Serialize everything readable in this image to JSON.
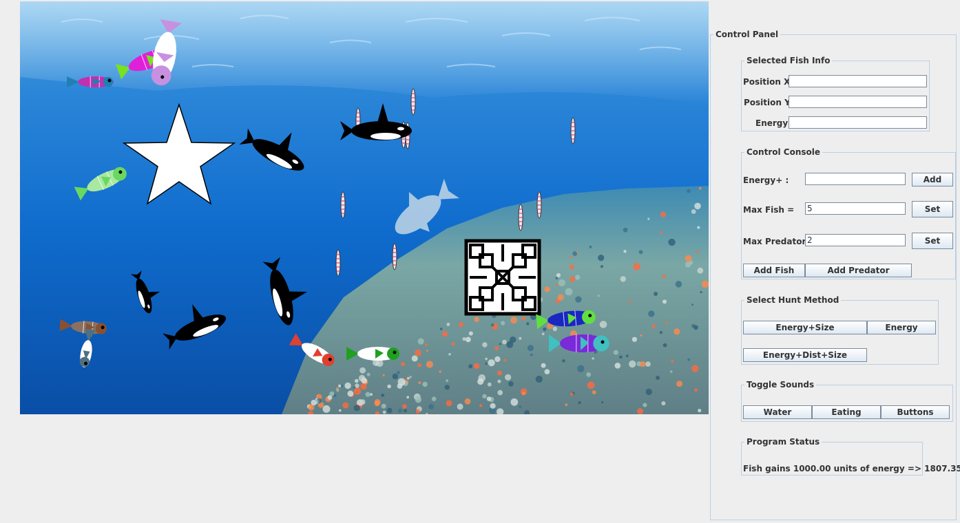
{
  "aquarium": {
    "fish_count": 10,
    "predator_count": 7,
    "colors": {
      "water_top": "#3f9fe0",
      "water_mid": "#0f6fcf",
      "water_deep": "#0a4fa8",
      "reef": "#6b9a9a"
    }
  },
  "control_panel": {
    "title": "Control Panel",
    "selected_fish_info": {
      "title": "Selected Fish Info",
      "position_x_label": "Position X :",
      "position_x_value": "",
      "position_y_label": "Position Y :",
      "position_y_value": "",
      "energy_label": "Energy :",
      "energy_value": ""
    },
    "control_console": {
      "title": "Control Console",
      "energy_plus_label": "Energy+ :",
      "energy_plus_value": "",
      "add_button": "Add",
      "max_fish_label": "Max Fish =",
      "max_fish_value": "5",
      "set_fish_button": "Set",
      "max_predator_label": "Max Predator =",
      "max_predator_value": "2",
      "set_predator_button": "Set",
      "add_fish_button": "Add Fish",
      "add_predator_button": "Add Predator"
    },
    "hunt_method": {
      "title": "Select Hunt Method",
      "energy_size_button": "Energy+Size",
      "energy_button": "Energy",
      "energy_dist_size_button": "Energy+Dist+Size"
    },
    "toggle_sounds": {
      "title": "Toggle Sounds",
      "water_button": "Water",
      "eating_button": "Eating",
      "buttons_button": "Buttons"
    },
    "program_status": {
      "title": "Program Status",
      "message": "Fish gains 1000.00 units of energy => 1807.35"
    }
  }
}
